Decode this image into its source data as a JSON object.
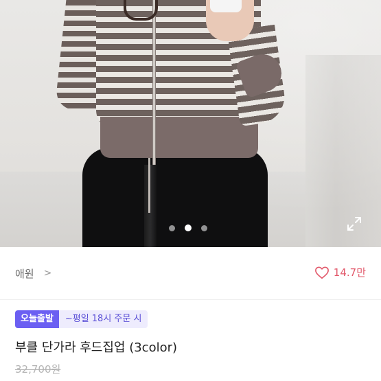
{
  "product_image": {
    "alt": "",
    "carousel": {
      "count": 3,
      "active_index": 1
    }
  },
  "icons": {
    "fullscreen": "expand-icon",
    "chevron": "chevron-right-icon",
    "heart": "heart-outline-icon"
  },
  "shop": {
    "name": "애원",
    "chevron": ">"
  },
  "likes": {
    "count": "14.7만"
  },
  "badges": {
    "primary": "오늘출발",
    "secondary": "~평일 18시 주문 시"
  },
  "product": {
    "title": "부클 단가라 후드집업 (3color)",
    "original_price": "32,700원"
  },
  "colors": {
    "accent_pink": "#e2586a",
    "badge_purple": "#6b5ff2",
    "badge_bg": "#eeecfd"
  }
}
